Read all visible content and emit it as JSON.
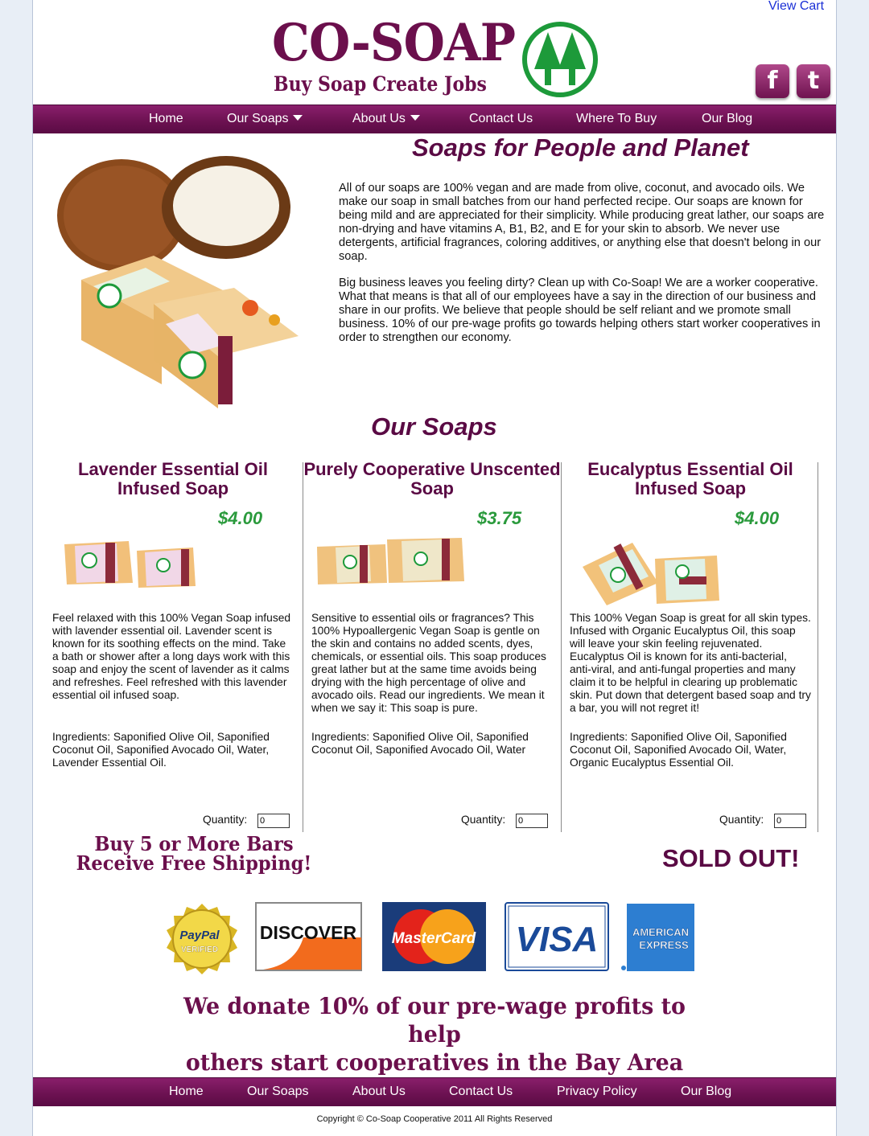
{
  "header": {
    "view_cart": "View Cart",
    "logo_text": "CO-SOAP",
    "logo_tagline": "Buy Soap Create Jobs",
    "social": {
      "facebook": "f",
      "twitter": "t"
    }
  },
  "nav": {
    "items": [
      {
        "label": "Home"
      },
      {
        "label": "Our Soaps"
      },
      {
        "label": "About Us"
      },
      {
        "label": "Contact Us"
      },
      {
        "label": "Where To Buy"
      },
      {
        "label": "Our Blog"
      }
    ]
  },
  "hero": {
    "title": "Soaps for People and Planet",
    "paragraphs": [
      "All of our soaps are 100% vegan and are made from olive, coconut, and avocado oils. We make our soap in small batches from our hand perfected recipe. Our soaps are known for being mild and are appreciated for their simplicity. While producing great lather, our soaps are non-drying and have vitamins A, B1, B2, and E for your skin to absorb. We never use detergents, artificial fragrances, coloring additives, or anything else that doesn't belong in our soap.",
      "Big business leaves you feeling dirty? Clean up with Co-Soap! We are a worker cooperative. What that means is that all of our employees have a say in the direction of our business and share in our profits. We believe that people should be self reliant and we promote small business. 10% of our pre-wage profits go towards helping others start worker cooperatives in order to strengthen our economy."
    ]
  },
  "soaps": {
    "title": "Our Soaps",
    "quantity_label": "Quantity:",
    "products": [
      {
        "name": "Lavender Essential Oil Infused Soap",
        "price": "$4.00",
        "description": "Feel relaxed with this 100% Vegan Soap infused with lavender essential oil. Lavender scent is known for its soothing effects on the mind. Take a bath or shower after a long days work with this soap and enjoy the scent of lavender as it calms and refreshes. Feel refreshed with this lavender essential oil infused soap.",
        "ingredients": "Ingredients: Saponified Olive Oil, Saponified Coconut Oil, Saponified Avocado Oil, Water, Lavender Essential Oil.",
        "quantity": "0"
      },
      {
        "name": "Purely Cooperative Unscented Soap",
        "price": "$3.75",
        "description": "Sensitive to essential oils or fragrances? This 100% Hypoallergenic Vegan Soap is gentle on the skin and contains no added scents, dyes, chemicals, or essential oils. This soap produces great lather but at the same time avoids being drying with the high percentage of olive and avocado oils. Read our ingredients. We mean it when we say it: This soap is pure.",
        "ingredients": "Ingredients: Saponified Olive Oil, Saponified Coconut Oil, Saponified Avocado Oil, Water",
        "quantity": "0"
      },
      {
        "name": "Eucalyptus Essential Oil Infused Soap",
        "price": "$4.00",
        "description": "This 100% Vegan Soap is great for all skin types. Infused with Organic Eucalyptus Oil, this soap will leave your skin feeling rejuvenated. Eucalyptus Oil is known for its anti-bacterial, anti-viral, and anti-fungal properties and many claim it to be helpful in clearing up problematic skin. Put down that detergent based soap and try a bar, you will not regret it!",
        "ingredients": "Ingredients: Saponified Olive Oil, Saponified Coconut Oil, Saponified Avocado Oil, Water, Organic Eucalyptus Essential Oil.",
        "quantity": "0"
      }
    ]
  },
  "promo": {
    "shipping_line1": "Buy 5 or More Bars",
    "shipping_line2": "Receive Free Shipping!",
    "sold_out": "SOLD OUT!"
  },
  "payments": {
    "paypal_top": "PayPal",
    "paypal_bottom": "VERIFIED",
    "discover": "DISCOVER",
    "mastercard": "MasterCard",
    "visa": "VISA",
    "amex_line1": "AMERICAN",
    "amex_line2": "EXPRESS"
  },
  "donate": {
    "line1": "We donate 10% of our pre-wage profits to help",
    "line2": "others start cooperatives in the Bay Area"
  },
  "footer": {
    "items": [
      {
        "label": "Home"
      },
      {
        "label": "Our Soaps"
      },
      {
        "label": "About Us"
      },
      {
        "label": "Contact Us"
      },
      {
        "label": "Privacy Policy"
      },
      {
        "label": "Our Blog"
      }
    ],
    "copyright": "Copyright © Co-Soap Cooperative 2011 All Rights Reserved"
  },
  "colors": {
    "brand_purple": "#6b0f4c",
    "price_green": "#2a9a3c",
    "link_blue": "#1a2fd6",
    "logo_green": "#1d9a3a"
  }
}
